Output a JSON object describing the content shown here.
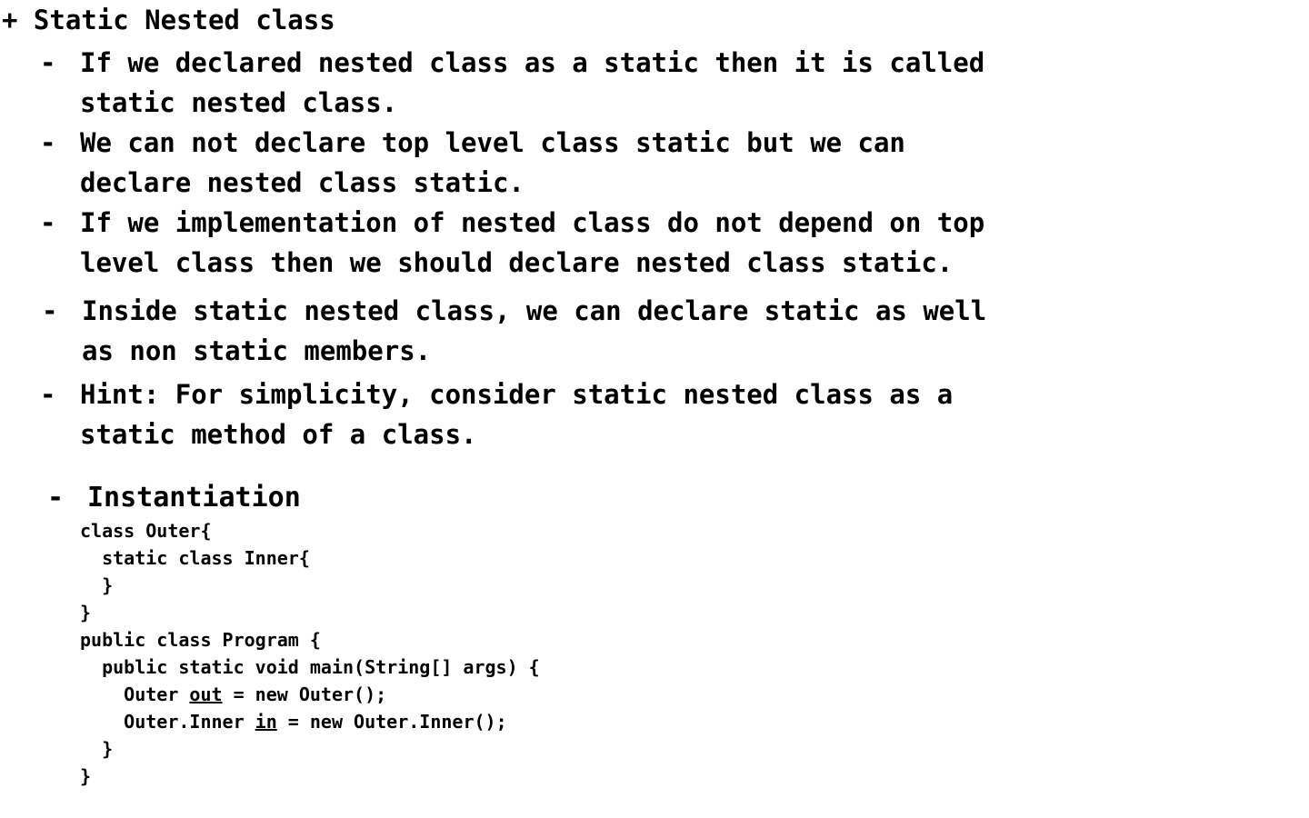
{
  "slide": {
    "title": "+ Static Nested class",
    "bullets": [
      {
        "dash": "-",
        "text": "If we declared nested class as a static then it is called\nstatic nested class."
      },
      {
        "dash": "-",
        "text": "We can not declare top level class static but we can\ndeclare nested class static."
      },
      {
        "dash": "-",
        "text": "If we implementation of nested class do not depend on top\nlevel class then we should declare nested class static."
      },
      {
        "dash": "-",
        "text": "Inside static nested class, we can declare static as well\nas non static members."
      },
      {
        "dash": "-",
        "text": "Hint: For simplicity, consider static nested class as a\nstatic method of a class."
      },
      {
        "dash": "-",
        "text": "Instantiation"
      }
    ],
    "code": {
      "l1": "class Outer{",
      "l2": "  static class Inner{",
      "l3": "  }",
      "l4": "}",
      "l5": "public class Program {",
      "l6": "  public static void main(String[] args) {",
      "l7_pre": "    Outer ",
      "l7_var": "out",
      "l7_post": " = new Outer();",
      "l8_pre": "    Outer.Inner ",
      "l8_var": "in",
      "l8_post": " = new Outer.Inner();",
      "l9": "  }",
      "l10": "}"
    }
  }
}
